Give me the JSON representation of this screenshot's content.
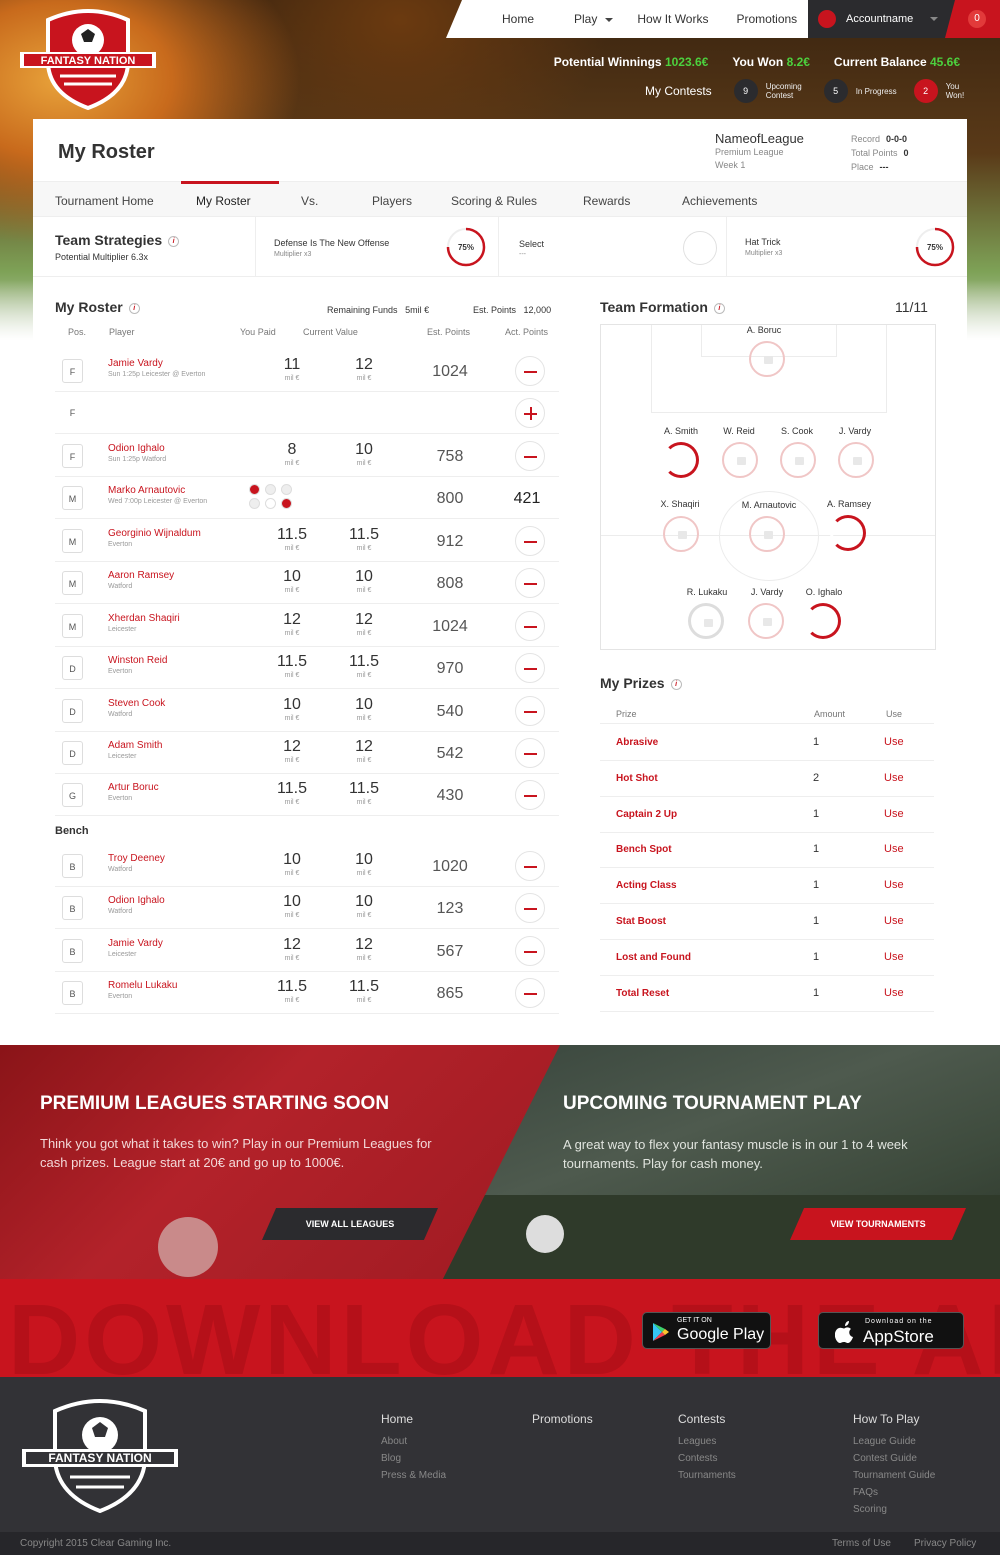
{
  "brand": {
    "name": "FANTASY NATION",
    "accent": "#c8141e"
  },
  "nav": {
    "home": "Home",
    "play": "Play",
    "how": "How It Works",
    "promotions": "Promotions",
    "account": "Accountname",
    "notifications": "0"
  },
  "stats": {
    "potential_label": "Potential Winnings",
    "potential_value": "1023.6€",
    "won_label": "You Won",
    "won_value": "8.2€",
    "balance_label": "Current Balance",
    "balance_value": "45.6€"
  },
  "my_contests": {
    "label": "My Contests",
    "upcoming": "9",
    "upcoming_label": "Upcoming Contest",
    "in_progress": "5",
    "in_progress_label": "In Progress",
    "won": "2",
    "won_label": "You Won!"
  },
  "roster_title": "My Roster",
  "league": {
    "name": "NameofLeague",
    "type": "Premium League",
    "week": "Week 1",
    "record_label": "Record",
    "record": "0-0-0",
    "total_label": "Total Points",
    "total": "0",
    "place_label": "Place",
    "place": "---"
  },
  "tabs": [
    "Tournament Home",
    "My Roster",
    "Vs.",
    "Players",
    "Scoring & Rules",
    "Rewards",
    "Achievements"
  ],
  "strategies": {
    "title": "Team Strategies",
    "multiplier": "Potential Multiplier 6.3x",
    "s1": {
      "name": "Defense Is The New Offense",
      "mult": "Multiplier x3",
      "pct": "75%"
    },
    "s2": {
      "name": "Select",
      "mult": "---"
    },
    "s3": {
      "name": "Hat Trick",
      "mult": "Multiplier x3",
      "pct": "75%"
    }
  },
  "roster": {
    "title": "My Roster",
    "funds_label": "Remaining Funds",
    "funds": "5mil €",
    "est_label": "Est. Points",
    "est": "12,000",
    "headers": {
      "pos": "Pos.",
      "player": "Player",
      "paid": "You Paid",
      "current": "Current Value",
      "est": "Est. Points",
      "act": "Act. Points"
    },
    "unit": "mil €",
    "bench_label": "Bench",
    "rows": [
      {
        "pos": "F",
        "name": "Jamie Vardy",
        "sub": "Sun 1:25p Leicester @ Everton",
        "paid": "11",
        "cur": "12",
        "est": "1024"
      },
      {
        "pos": "F",
        "empty": true
      },
      {
        "pos": "F",
        "name": "Odion Ighalo",
        "sub": "Sun 1:25p Watford",
        "paid": "8",
        "cur": "10",
        "est": "758"
      },
      {
        "pos": "M",
        "name": "Marko Arnautovic",
        "sub": "Wed 7:00p Leicester @ Everton",
        "est": "800",
        "act": "421",
        "live": true
      },
      {
        "pos": "M",
        "name": "Georginio Wijnaldum",
        "sub": "Everton",
        "paid": "11.5",
        "cur": "11.5",
        "est": "912"
      },
      {
        "pos": "M",
        "name": "Aaron Ramsey",
        "sub": "Watford",
        "paid": "10",
        "cur": "10",
        "est": "808"
      },
      {
        "pos": "M",
        "name": "Xherdan Shaqiri",
        "sub": "Leicester",
        "paid": "12",
        "cur": "12",
        "est": "1024"
      },
      {
        "pos": "D",
        "name": "Winston Reid",
        "sub": "Everton",
        "paid": "11.5",
        "cur": "11.5",
        "est": "970"
      },
      {
        "pos": "D",
        "name": "Steven Cook",
        "sub": "Watford",
        "paid": "10",
        "cur": "10",
        "est": "540"
      },
      {
        "pos": "D",
        "name": "Adam Smith",
        "sub": "Leicester",
        "paid": "12",
        "cur": "12",
        "est": "542"
      },
      {
        "pos": "G",
        "name": "Artur Boruc",
        "sub": "Everton",
        "paid": "11.5",
        "cur": "11.5",
        "est": "430"
      }
    ],
    "bench": [
      {
        "pos": "B",
        "name": "Troy Deeney",
        "sub": "Watford",
        "paid": "10",
        "cur": "10",
        "est": "1020"
      },
      {
        "pos": "B",
        "name": "Odion Ighalo",
        "sub": "Watford",
        "paid": "10",
        "cur": "10",
        "est": "123"
      },
      {
        "pos": "B",
        "name": "Jamie Vardy",
        "sub": "Leicester",
        "paid": "12",
        "cur": "12",
        "est": "567"
      },
      {
        "pos": "B",
        "name": "Romelu Lukaku",
        "sub": "Everton",
        "paid": "11.5",
        "cur": "11.5",
        "est": "865"
      }
    ]
  },
  "formation": {
    "title": "Team Formation",
    "count": "11/11",
    "players": {
      "gk": "A. Boruc",
      "d1": "A. Smith",
      "d2": "W. Reid",
      "d3": "S. Cook",
      "d4": "J. Vardy",
      "m1": "X. Shaqiri",
      "m2": "M. Arnautovic",
      "m3": "A. Ramsey",
      "f1": "R. Lukaku",
      "f2": "J. Vardy",
      "f3": "O. Ighalo"
    }
  },
  "prizes": {
    "title": "My Prizes",
    "h_prize": "Prize",
    "h_amount": "Amount",
    "h_use": "Use",
    "items": [
      {
        "name": "Abrasive",
        "amount": "1",
        "use": "Use"
      },
      {
        "name": "Hot Shot",
        "amount": "2",
        "use": "Use"
      },
      {
        "name": "Captain 2 Up",
        "amount": "1",
        "use": "Use"
      },
      {
        "name": "Bench Spot",
        "amount": "1",
        "use": "Use"
      },
      {
        "name": "Acting Class",
        "amount": "1",
        "use": "Use"
      },
      {
        "name": "Stat Boost",
        "amount": "1",
        "use": "Use"
      },
      {
        "name": "Lost and Found",
        "amount": "1",
        "use": "Use"
      },
      {
        "name": "Total Reset",
        "amount": "1",
        "use": "Use"
      }
    ]
  },
  "promo": {
    "left": {
      "title": "PREMIUM LEAGUES STARTING SOON",
      "text": "Think you got what it takes to win? Play in our Premium Leagues for cash prizes. League start at 20€ and go up to 1000€.",
      "button": "VIEW ALL LEAGUES"
    },
    "right": {
      "title": "UPCOMING TOURNAMENT PLAY",
      "text": "A great way to flex your fantasy muscle is in our 1 to 4 week tournaments. Play for cash money.",
      "button": "VIEW TOURNAMENTS"
    }
  },
  "download": {
    "text": "DOWNLOAD THE APP",
    "gp_small": "GET IT ON",
    "gp_big": "Google Play",
    "as_small": "Download on the",
    "as_big": "AppStore"
  },
  "footer": {
    "cols": [
      {
        "h": "Home",
        "links": [
          "About",
          "Blog",
          "Press & Media"
        ]
      },
      {
        "h": "Promotions",
        "links": []
      },
      {
        "h": "Contests",
        "links": [
          "Leagues",
          "Contests",
          "Tournaments"
        ]
      },
      {
        "h": "How To Play",
        "links": [
          "League Guide",
          "Contest Guide",
          "Tournament Guide",
          "FAQs",
          "Scoring"
        ]
      }
    ],
    "copyright": "Copyright 2015 Clear Gaming Inc.",
    "terms": "Terms of Use",
    "privacy": "Privacy Policy"
  }
}
